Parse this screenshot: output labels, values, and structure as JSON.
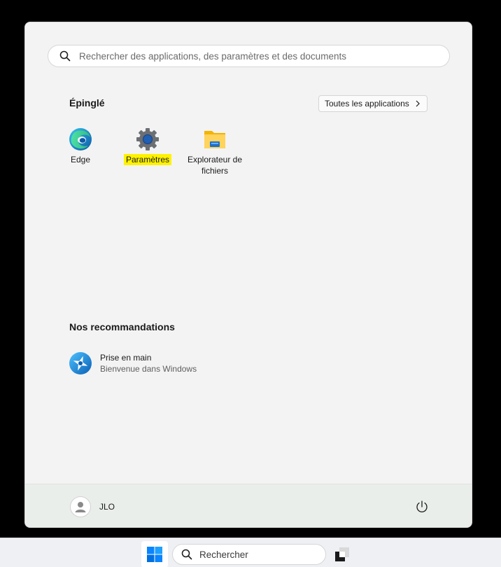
{
  "search": {
    "placeholder": "Rechercher des applications, des paramètres et des documents"
  },
  "pinned": {
    "title": "Épinglé",
    "all_apps_label": "Toutes les applications",
    "apps": [
      {
        "label": "Edge",
        "icon": "edge-icon"
      },
      {
        "label": "Paramètres",
        "icon": "settings-gear-icon",
        "highlighted": true
      },
      {
        "label": "Explorateur de fichiers",
        "icon": "file-explorer-icon"
      }
    ]
  },
  "recommended": {
    "title": "Nos recommandations",
    "items": [
      {
        "title": "Prise en main",
        "subtitle": "Bienvenue dans Windows",
        "icon": "get-started-icon"
      }
    ]
  },
  "footer": {
    "user_name": "JLO"
  },
  "taskbar": {
    "search_label": "Rechercher"
  },
  "colors": {
    "highlight": "#fff200",
    "menu_bg": "#f3f3f3",
    "accent": "#0078d4"
  }
}
